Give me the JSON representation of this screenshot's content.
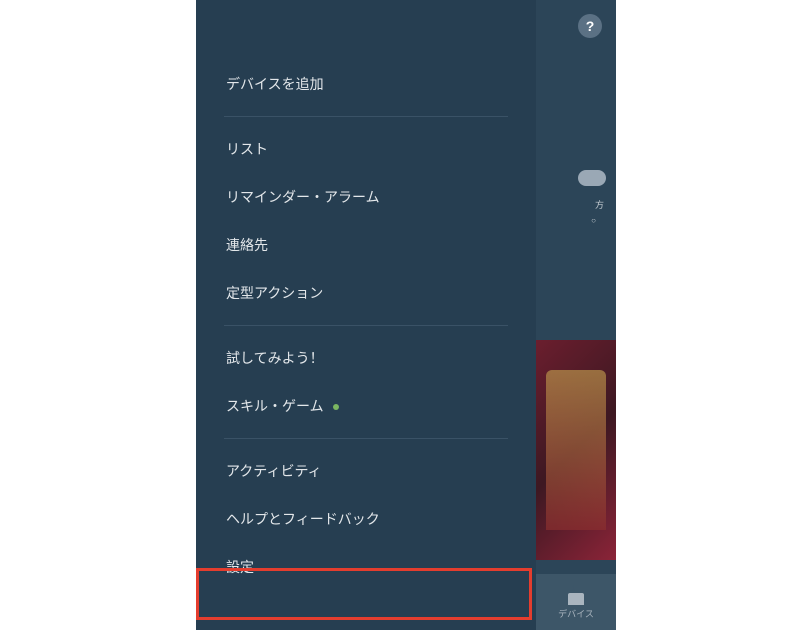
{
  "drawer": {
    "groups": [
      {
        "items": [
          {
            "label": "デバイスを追加",
            "has_badge": false
          }
        ]
      },
      {
        "items": [
          {
            "label": "リスト",
            "has_badge": false
          },
          {
            "label": "リマインダー・アラーム",
            "has_badge": false
          },
          {
            "label": "連絡先",
            "has_badge": false
          },
          {
            "label": "定型アクション",
            "has_badge": false
          }
        ]
      },
      {
        "items": [
          {
            "label": "試してみよう！",
            "has_badge": false
          },
          {
            "label": "スキル・ゲーム",
            "has_badge": true
          }
        ]
      },
      {
        "items": [
          {
            "label": "アクティビティ",
            "has_badge": false
          },
          {
            "label": "ヘルプとフィードバック",
            "has_badge": false
          },
          {
            "label": "設定",
            "has_badge": false,
            "highlighted": true
          }
        ]
      }
    ]
  },
  "background": {
    "help_symbol": "?",
    "weather_fragment": "方",
    "dots": "○",
    "nav_label": "デバイス"
  },
  "colors": {
    "drawer_bg": "#263e51",
    "highlight_border": "#e43d2e",
    "badge_green": "#7bb661"
  }
}
